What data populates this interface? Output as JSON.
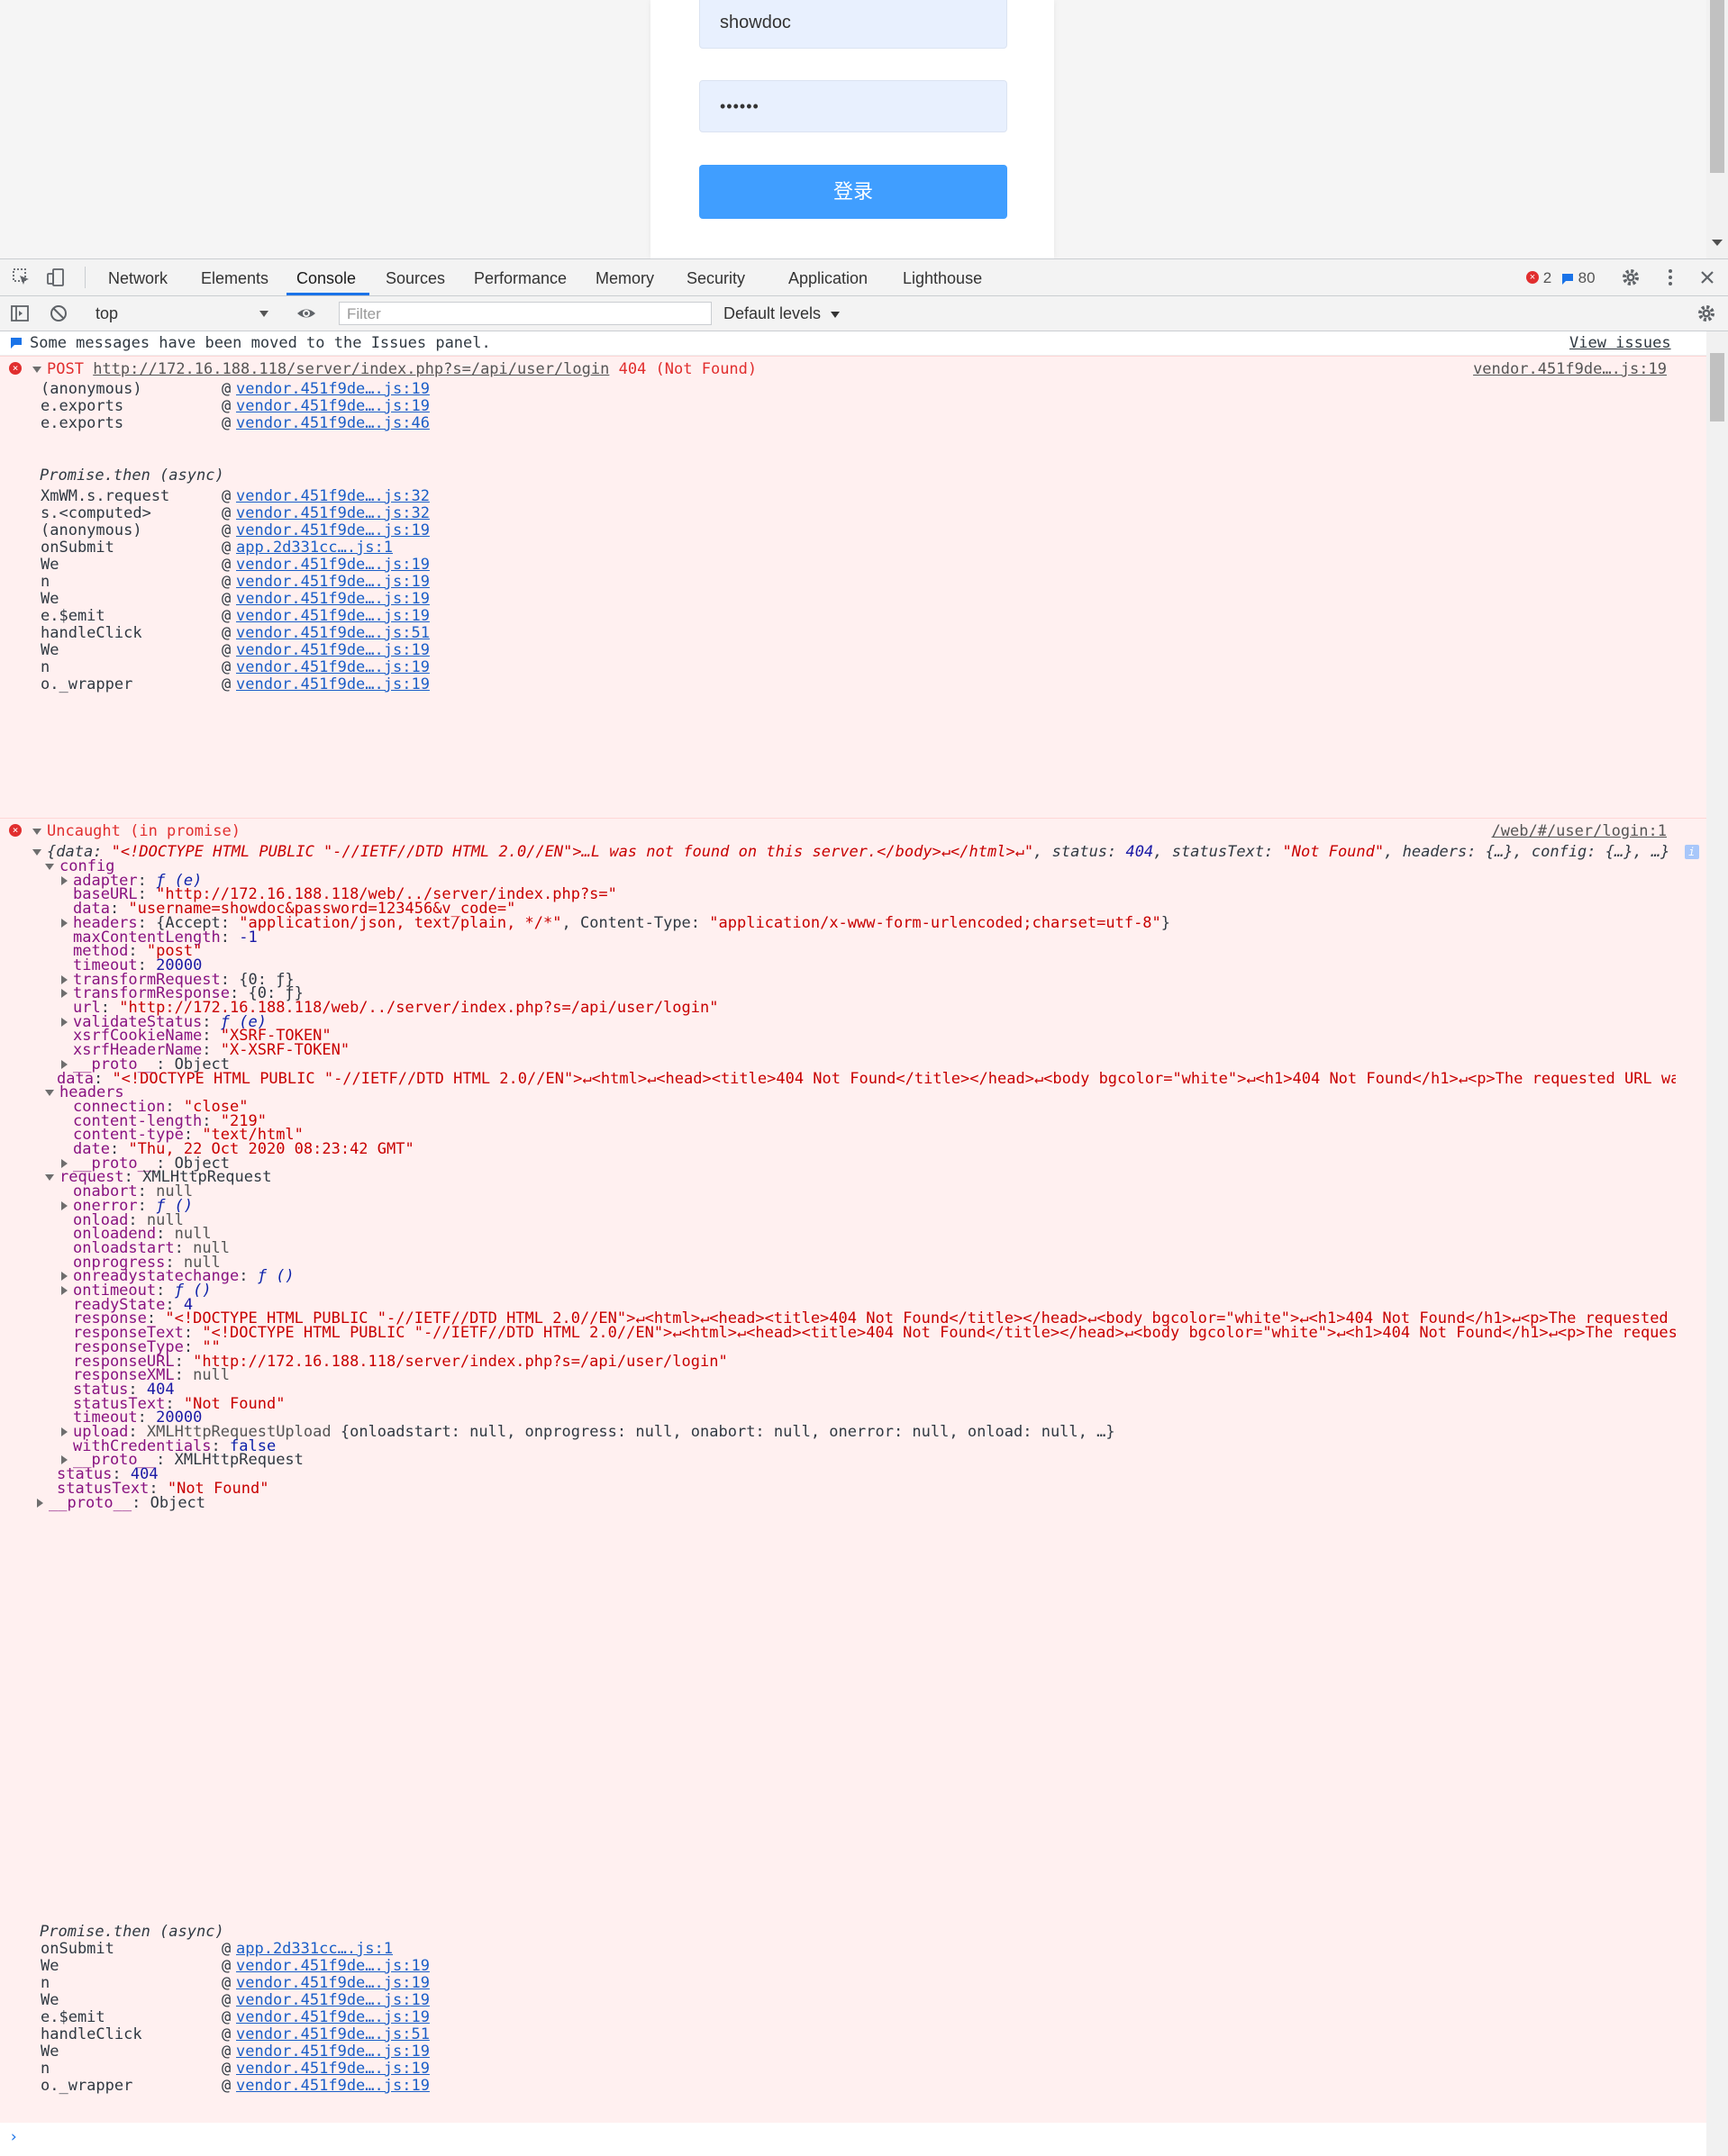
{
  "login": {
    "username": "showdoc",
    "password_mask": "••••••",
    "submit_label": "登录"
  },
  "devtools": {
    "tabs": [
      "Network",
      "Elements",
      "Console",
      "Sources",
      "Performance",
      "Memory",
      "Security",
      "Application",
      "Lighthouse"
    ],
    "active_tab": "Console",
    "error_count": "2",
    "message_count": "80",
    "context": "top",
    "filter_placeholder": "Filter",
    "levels": "Default levels"
  },
  "console": {
    "issues_notice": "Some messages have been moved to the Issues panel.",
    "view_issues": "View issues",
    "post_error": {
      "method": "POST",
      "url": "http://172.16.188.118/server/index.php?s=/api/user/login",
      "status": "404 (Not Found)",
      "source": "vendor.451f9de….js:19",
      "stack1": [
        {
          "fn": "(anonymous)",
          "loc": "vendor.451f9de….js:19"
        },
        {
          "fn": "e.exports",
          "loc": "vendor.451f9de….js:19"
        },
        {
          "fn": "e.exports",
          "loc": "vendor.451f9de….js:46"
        }
      ],
      "async_label": "Promise.then (async)",
      "stack2": [
        {
          "fn": "XmWM.s.request",
          "loc": "vendor.451f9de….js:32"
        },
        {
          "fn": "s.<computed>",
          "loc": "vendor.451f9de….js:32"
        },
        {
          "fn": "(anonymous)",
          "loc": "vendor.451f9de….js:19"
        },
        {
          "fn": "onSubmit",
          "loc": "app.2d331cc….js:1"
        },
        {
          "fn": "We",
          "loc": "vendor.451f9de….js:19"
        },
        {
          "fn": "n",
          "loc": "vendor.451f9de….js:19"
        },
        {
          "fn": "We",
          "loc": "vendor.451f9de….js:19"
        },
        {
          "fn": "e.$emit",
          "loc": "vendor.451f9de….js:19"
        },
        {
          "fn": "handleClick",
          "loc": "vendor.451f9de….js:51"
        },
        {
          "fn": "We",
          "loc": "vendor.451f9de….js:19"
        },
        {
          "fn": "n",
          "loc": "vendor.451f9de….js:19"
        },
        {
          "fn": "o._wrapper",
          "loc": "vendor.451f9de….js:19"
        }
      ]
    },
    "uncaught": {
      "title": "Uncaught (in promise)",
      "source": "/web/#/user/login:1",
      "summary_open": "{data: ",
      "summary_data": "\"<!DOCTYPE HTML PUBLIC \"-//IETF//DTD HTML 2.0//EN\">…L was not found on this server.</body>↵</html>↵\"",
      "summary_rest": ", status: ",
      "summary_status": "404",
      "summary_rest2": ", statusText: ",
      "summary_statustext": "\"Not Found\"",
      "summary_tail": ", headers: {…}, config: {…}, …}",
      "info_badge": "i",
      "config_label": "config",
      "adapter": "ƒ (e)",
      "baseURL": "\"http://172.16.188.118/web/../server/index.php?s=\"",
      "data": "\"username=showdoc&password=123456&v_code=\"",
      "headers_accept": "\"application/json, text/plain, */*\"",
      "headers_ct": "\"application/x-www-form-urlencoded;charset=utf-8\"",
      "maxContentLength": "-1",
      "method": "\"post\"",
      "timeout": "20000",
      "transformRequest": "{0: ƒ}",
      "transformResponse": "{0: ƒ}",
      "url": "\"http://172.16.188.118/web/../server/index.php?s=/api/user/login\"",
      "validateStatus": "ƒ (e)",
      "xsrfCookieName": "\"XSRF-TOKEN\"",
      "xsrfHeaderName": "\"X-XSRF-TOKEN\"",
      "proto_object": "Object",
      "data_line": "\"<!DOCTYPE HTML PUBLIC \"-//IETF//DTD HTML 2.0//EN\">↵<html>↵<head><title>404 Not Found</title></head>↵<body bgcolor=\"white\">↵<h1>404 Not Found</h1>↵<p>The requested URL was n…",
      "resp_headers": {
        "connection": "\"close\"",
        "content_length": "\"219\"",
        "content_type": "\"text/html\"",
        "date": "\"Thu, 22 Oct 2020 08:23:42 GMT\""
      },
      "request_type": "XMLHttpRequest",
      "req": {
        "onabort": "null",
        "onerror": "ƒ ()",
        "onload": "null",
        "onloadend": "null",
        "onloadstart": "null",
        "onprogress": "null",
        "onreadystatechange": "ƒ ()",
        "ontimeout": "ƒ ()",
        "readyState": "4",
        "response": "\"<!DOCTYPE HTML PUBLIC \"-//IETF//DTD HTML 2.0//EN\">↵<html>↵<head><title>404 Not Found</title></head>↵<body bgcolor=\"white\">↵<h1>404 Not Found</h1>↵<p>The requested URL …",
        "responseText": "\"<!DOCTYPE HTML PUBLIC \"-//IETF//DTD HTML 2.0//EN\">↵<html>↵<head><title>404 Not Found</title></head>↵<body bgcolor=\"white\">↵<h1>404 Not Found</h1>↵<p>The requested …",
        "responseType": "\"\"",
        "responseURL": "\"http://172.16.188.118/server/index.php?s=/api/user/login\"",
        "responseXML": "null",
        "status": "404",
        "statusText": "\"Not Found\"",
        "timeout": "20000",
        "upload_type": "XMLHttpRequestUpload",
        "upload_preview": "{onloadstart: null, onprogress: null, onabort: null, onerror: null, onload: null, …}",
        "withCredentials": "false",
        "proto": "XMLHttpRequest"
      },
      "status": "404",
      "statusText": "\"Not Found\"",
      "async_label": "Promise.then (async)",
      "stack": [
        {
          "fn": "onSubmit",
          "loc": "app.2d331cc….js:1"
        },
        {
          "fn": "We",
          "loc": "vendor.451f9de….js:19"
        },
        {
          "fn": "n",
          "loc": "vendor.451f9de….js:19"
        },
        {
          "fn": "We",
          "loc": "vendor.451f9de….js:19"
        },
        {
          "fn": "e.$emit",
          "loc": "vendor.451f9de….js:19"
        },
        {
          "fn": "handleClick",
          "loc": "vendor.451f9de….js:51"
        },
        {
          "fn": "We",
          "loc": "vendor.451f9de….js:19"
        },
        {
          "fn": "n",
          "loc": "vendor.451f9de….js:19"
        },
        {
          "fn": "o._wrapper",
          "loc": "vendor.451f9de….js:19"
        }
      ]
    }
  }
}
